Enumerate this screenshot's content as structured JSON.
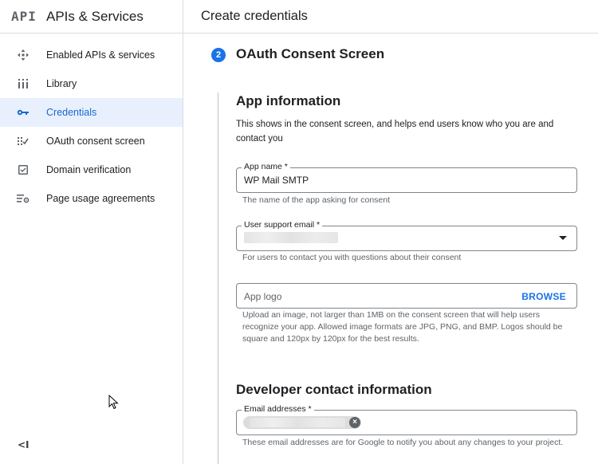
{
  "sidebar": {
    "logo": "API",
    "title": "APIs & Services",
    "items": [
      {
        "label": "Enabled APIs & services",
        "icon": "diamond-arrows-icon",
        "active": false
      },
      {
        "label": "Library",
        "icon": "library-icon",
        "active": false
      },
      {
        "label": "Credentials",
        "icon": "key-icon",
        "active": true
      },
      {
        "label": "OAuth consent screen",
        "icon": "consent-screen-icon",
        "active": false
      },
      {
        "label": "Domain verification",
        "icon": "checkbox-icon",
        "active": false
      },
      {
        "label": "Page usage agreements",
        "icon": "settings-list-icon",
        "active": false
      }
    ],
    "collapse_label": "<I"
  },
  "main": {
    "header_title": "Create credentials",
    "step_number": "2",
    "step_title": "OAuth Consent Screen",
    "app_info": {
      "title": "App information",
      "description": "This shows in the consent screen, and helps end users know who you are and contact you",
      "app_name": {
        "label": "App name *",
        "value": "WP Mail SMTP",
        "hint": "The name of the app asking for consent"
      },
      "support_email": {
        "label": "User support email *",
        "hint": "For users to contact you with questions about their consent"
      },
      "app_logo": {
        "placeholder": "App logo",
        "button": "BROWSE",
        "hint": "Upload an image, not larger than 1MB on the consent screen that will help users recognize your app. Allowed image formats are JPG, PNG, and BMP. Logos should be square and 120px by 120px for the best results."
      }
    },
    "developer_contact": {
      "title": "Developer contact information",
      "email": {
        "label": "Email addresses *",
        "hint": "These email addresses are for Google to notify you about any changes to your project."
      }
    }
  },
  "colors": {
    "accent": "#1a73e8",
    "active_bg": "#e8f0fe",
    "active_text": "#1967d2"
  }
}
